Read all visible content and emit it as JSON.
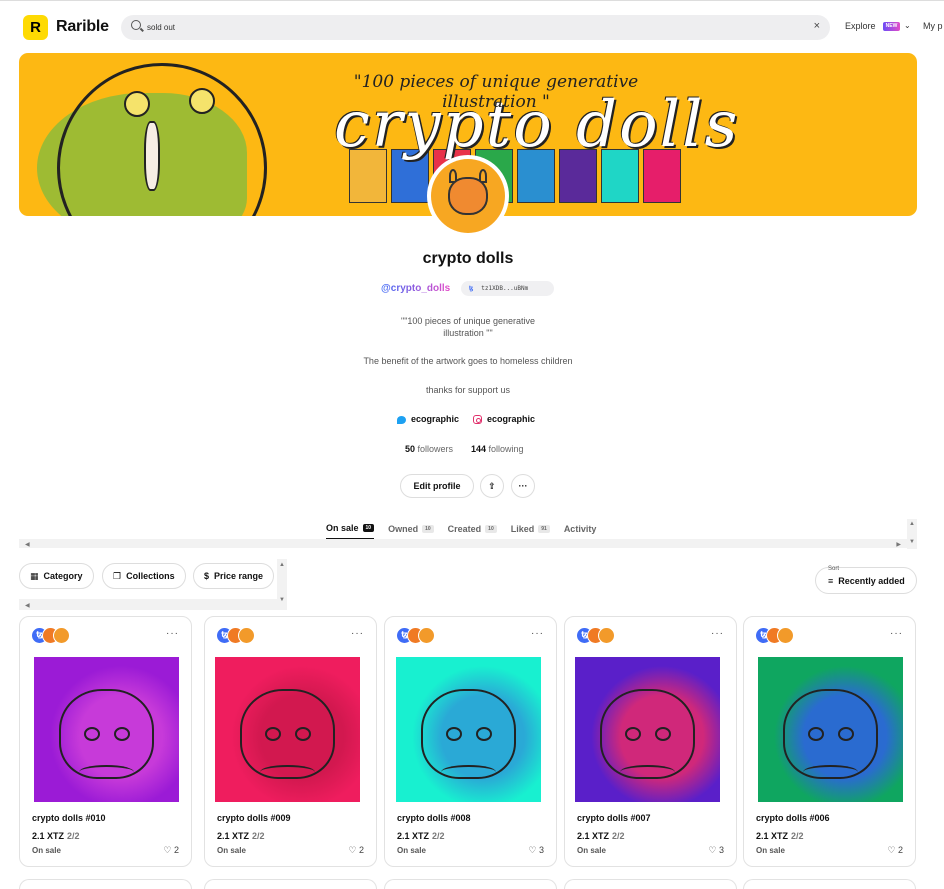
{
  "header": {
    "brand": "Rarible",
    "search_value": "sold out",
    "clear": "×",
    "explore": "Explore",
    "new_badge": "NEW",
    "my_profile": "My p"
  },
  "banner": {
    "tagline": "\"100 pieces of unique generative illustration \"",
    "title": "crypto dolls",
    "tile_colors": [
      "#f2b63a",
      "#2f6fd8",
      "#e8324a",
      "#2aa84a",
      "#2a8fd0",
      "#5a2a9a",
      "#1fd6c6",
      "#e61e6a"
    ]
  },
  "profile": {
    "name": "crypto dolls",
    "handle": "@crypto_dolls",
    "address_prefix": "ꜩ",
    "address": "tz1XDB...uBNm",
    "bio_line1": "\"\"100 pieces of unique generative",
    "bio_line2": "illustration \"\"",
    "bio_line3": "The benefit of the artwork goes to homeless children",
    "bio_line4": "thanks for support us",
    "twitter": "ecographic",
    "instagram": "ecographic",
    "followers_count": "50",
    "followers_label": "followers",
    "following_count": "144",
    "following_label": "following",
    "edit_profile": "Edit profile",
    "share_icon": "⇪",
    "more_icon": "···"
  },
  "tabs": [
    {
      "label": "On sale",
      "count": "10"
    },
    {
      "label": "Owned",
      "count": "10"
    },
    {
      "label": "Created",
      "count": "10"
    },
    {
      "label": "Liked",
      "count": "91"
    },
    {
      "label": "Activity",
      "count": ""
    }
  ],
  "filters": {
    "category": "Category",
    "collections": "Collections",
    "price_range": "Price range",
    "sort_label": "Sort",
    "sort_value": "Recently added"
  },
  "cards": [
    {
      "title": "crypto dolls #010",
      "price": "2.1 XTZ",
      "edition": "2/2",
      "status": "On sale",
      "likes": "2",
      "bg": "#9b1bd6",
      "blob": "#c73ad9"
    },
    {
      "title": "crypto dolls #009",
      "price": "2.1 XTZ",
      "edition": "2/2",
      "status": "On sale",
      "likes": "2",
      "bg": "#ef1d5e",
      "blob": "#d2184f"
    },
    {
      "title": "crypto dolls #008",
      "price": "2.1 XTZ",
      "edition": "2/2",
      "status": "On sale",
      "likes": "3",
      "bg": "#18f0d0",
      "blob": "#2aa9d6"
    },
    {
      "title": "crypto dolls #007",
      "price": "2.1 XTZ",
      "edition": "2/2",
      "status": "On sale",
      "likes": "3",
      "bg": "#5a1fc9",
      "blob": "#d0287a"
    },
    {
      "title": "crypto dolls #006",
      "price": "2.1 XTZ",
      "edition": "2/2",
      "status": "On sale",
      "likes": "2",
      "bg": "#0fa660",
      "blob": "#2a6bd0"
    }
  ]
}
